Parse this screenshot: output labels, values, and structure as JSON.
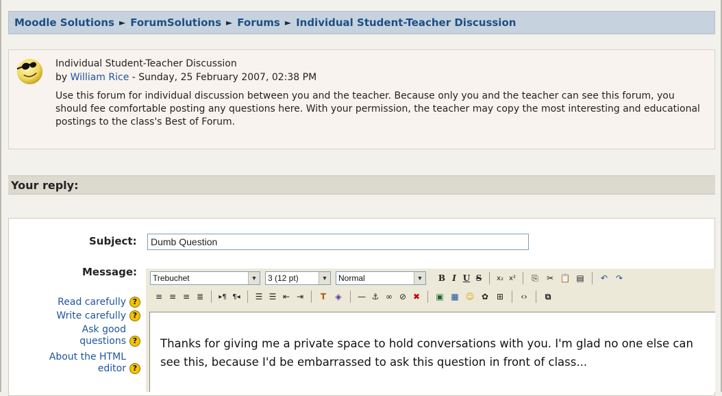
{
  "breadcrumb": {
    "items": [
      "Moodle Solutions",
      "ForumSolutions",
      "Forums",
      "Individual Student-Teacher Discussion"
    ],
    "separator": "►"
  },
  "intro_post": {
    "title": "Individual Student-Teacher Discussion",
    "by_prefix": "by",
    "author": "William Rice",
    "date": " - Sunday, 25 February 2007, 02:38 PM",
    "body": "Use this forum for individual discussion between you and the teacher. Because only you and the teacher can see this forum, you should fee comfortable posting any questions here. With your permission, the teacher may copy the most interesting and educational postings to the class's Best of Forum."
  },
  "reply": {
    "header": "Your reply:",
    "subject_label": "Subject:",
    "subject_value": "Dumb Question",
    "message_label": "Message:",
    "message_text": "Thanks for giving me a private space to hold conversations with you. I'm glad no one else can see this, because I'd be embarrassed to ask this question in front of class..."
  },
  "help_links": [
    {
      "label": "Read carefully"
    },
    {
      "label": "Write carefully"
    },
    {
      "label": "Ask good questions"
    },
    {
      "label": "About the HTML editor"
    }
  ],
  "help_icon_glyph": "?",
  "editor": {
    "font_value": "Trebuchet",
    "size_value": "3 (12 pt)",
    "style_value": "Normal"
  },
  "colors": {
    "link": "#1d55a0",
    "breadcrumb_bg": "#c6d3df",
    "help_icon": "#f5c400"
  }
}
